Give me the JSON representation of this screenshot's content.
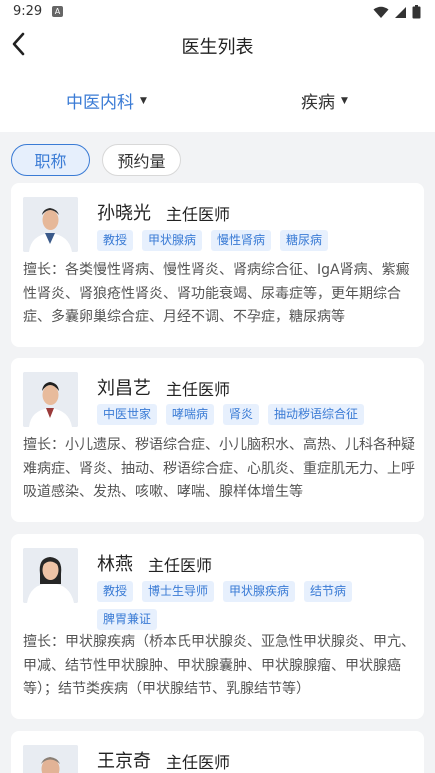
{
  "status": {
    "time": "9:29",
    "app_badge": "A"
  },
  "header": {
    "title": "医生列表"
  },
  "filters": {
    "department": "中医内科",
    "disease": "疾病"
  },
  "sort": {
    "title_label": "职称",
    "booking_label": "预约量"
  },
  "doctors": [
    {
      "name": "孙晓光",
      "title": "主任医师",
      "tags": [
        "教授",
        "甲状腺病",
        "慢性肾病",
        "糖尿病"
      ],
      "desc": "擅长：各类慢性肾病、慢性肾炎、肾病综合征、IgA肾病、紫癜性肾炎、肾狼疮性肾炎、肾功能衰竭、尿毒症等，更年期综合症、多囊卵巢综合症、月经不调、不孕症，糖尿病等"
    },
    {
      "name": "刘昌艺",
      "title": "主任医师",
      "tags": [
        "中医世家",
        "哮喘病",
        "肾炎",
        "抽动秽语综合征"
      ],
      "desc": "擅长：小儿遗尿、秽语综合症、小儿脑积水、高热、儿科各种疑难病症、肾炎、抽动、秽语综合症、心肌炎、重症肌无力、上呼吸道感染、发热、咳嗽、哮喘、腺样体增生等"
    },
    {
      "name": "林燕",
      "title": "主任医师",
      "tags": [
        "教授",
        "博士生导师",
        "甲状腺疾病",
        "结节病",
        "脾胃兼证"
      ],
      "desc": "擅长：甲状腺疾病（桥本氏甲状腺炎、亚急性甲状腺炎、甲亢、甲减、结节性甲状腺肿、甲状腺囊肿、甲状腺腺瘤、甲状腺癌等）；结节类疾病（甲状腺结节、乳腺结节等）"
    },
    {
      "name": "王京奇",
      "title": "主任医师",
      "tags": [],
      "desc": ""
    }
  ]
}
